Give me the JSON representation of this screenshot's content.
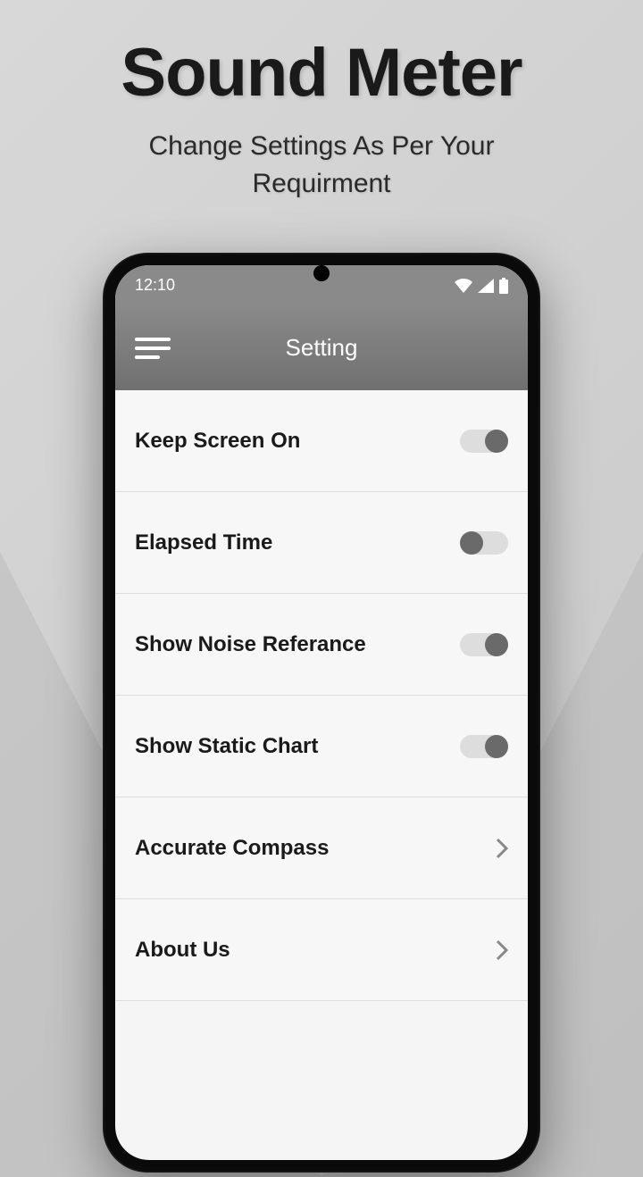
{
  "promo": {
    "title": "Sound Meter",
    "subtitle_line1": "Change Settings As Per Your",
    "subtitle_line2": "Requirment"
  },
  "status_bar": {
    "time": "12:10"
  },
  "header": {
    "title": "Setting"
  },
  "settings": [
    {
      "label": "Keep Screen On",
      "type": "toggle",
      "state": "on"
    },
    {
      "label": "Elapsed Time",
      "type": "toggle",
      "state": "off"
    },
    {
      "label": "Show Noise Referance",
      "type": "toggle",
      "state": "on"
    },
    {
      "label": "Show Static Chart",
      "type": "toggle",
      "state": "on"
    },
    {
      "label": "Accurate  Compass",
      "type": "link"
    },
    {
      "label": "About Us",
      "type": "link"
    }
  ]
}
